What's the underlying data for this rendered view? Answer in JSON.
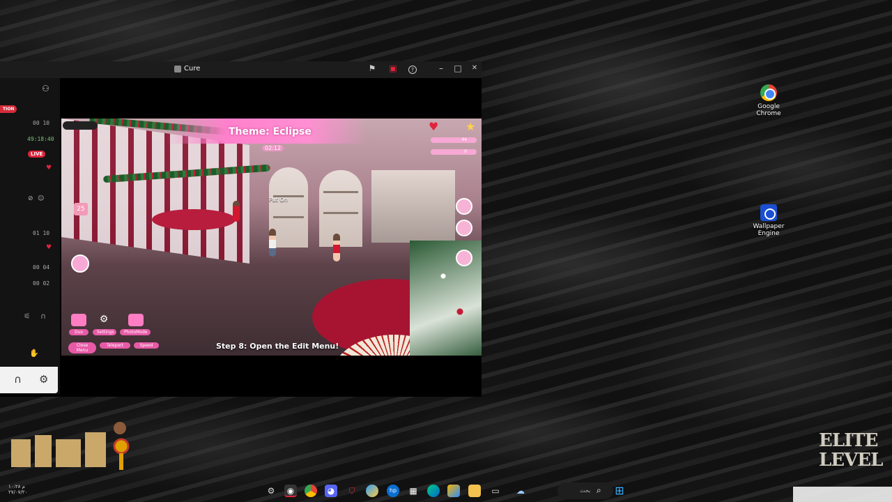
{
  "desktop": {
    "icons": [
      {
        "label_line1": "Google",
        "label_line2": "Chrome",
        "icon": "chrome-icon"
      },
      {
        "label_line1": "Wallpaper",
        "label_line2": "Engine",
        "icon": "wallpaper-engine-icon"
      }
    ]
  },
  "window": {
    "title": "Cure",
    "controls": {
      "minimize": "–",
      "maximize": "□",
      "close": "✕"
    },
    "toolbar_icons": [
      "flag-icon",
      "record-icon",
      "help-icon"
    ],
    "help_glyph": "?"
  },
  "side_panel": {
    "badge": "TION",
    "live": "LIVE",
    "rows": [
      "00  10",
      "49:18:40",
      "01  10",
      "00  04",
      "00  02"
    ]
  },
  "game": {
    "theme_title": "Theme: Eclipse",
    "timer": "02:12",
    "hud_value_1": "44",
    "hud_value_2": "0",
    "prompt": "Put On",
    "counter": "25",
    "step_text": "Step 8: Open the Edit Menu!",
    "bottom_buttons": [
      "Duo",
      "Settings",
      "PhotoMode",
      "Close Menu",
      "Teleport",
      "Speed"
    ]
  },
  "taskbar": {
    "search_placeholder": "بحث",
    "icons": [
      "settings-icon",
      "app-icon",
      "chrome-icon",
      "discord-icon",
      "shield-icon",
      "copilot-icon",
      "hp-icon",
      "store-icon",
      "edge-icon",
      "app2-icon",
      "folder-icon",
      "window-icon",
      "weather-icon"
    ],
    "start_icon": "windows-start-icon"
  },
  "clock": {
    "time": "۱۰:۲۸ م",
    "date": "٢٧/٠٧/٢٠"
  },
  "watermarks": {
    "right_line1": "ELITE",
    "right_line2": "LEVEL"
  },
  "colors": {
    "accent_pink": "#ff80cc",
    "live_red": "#e0243c"
  }
}
